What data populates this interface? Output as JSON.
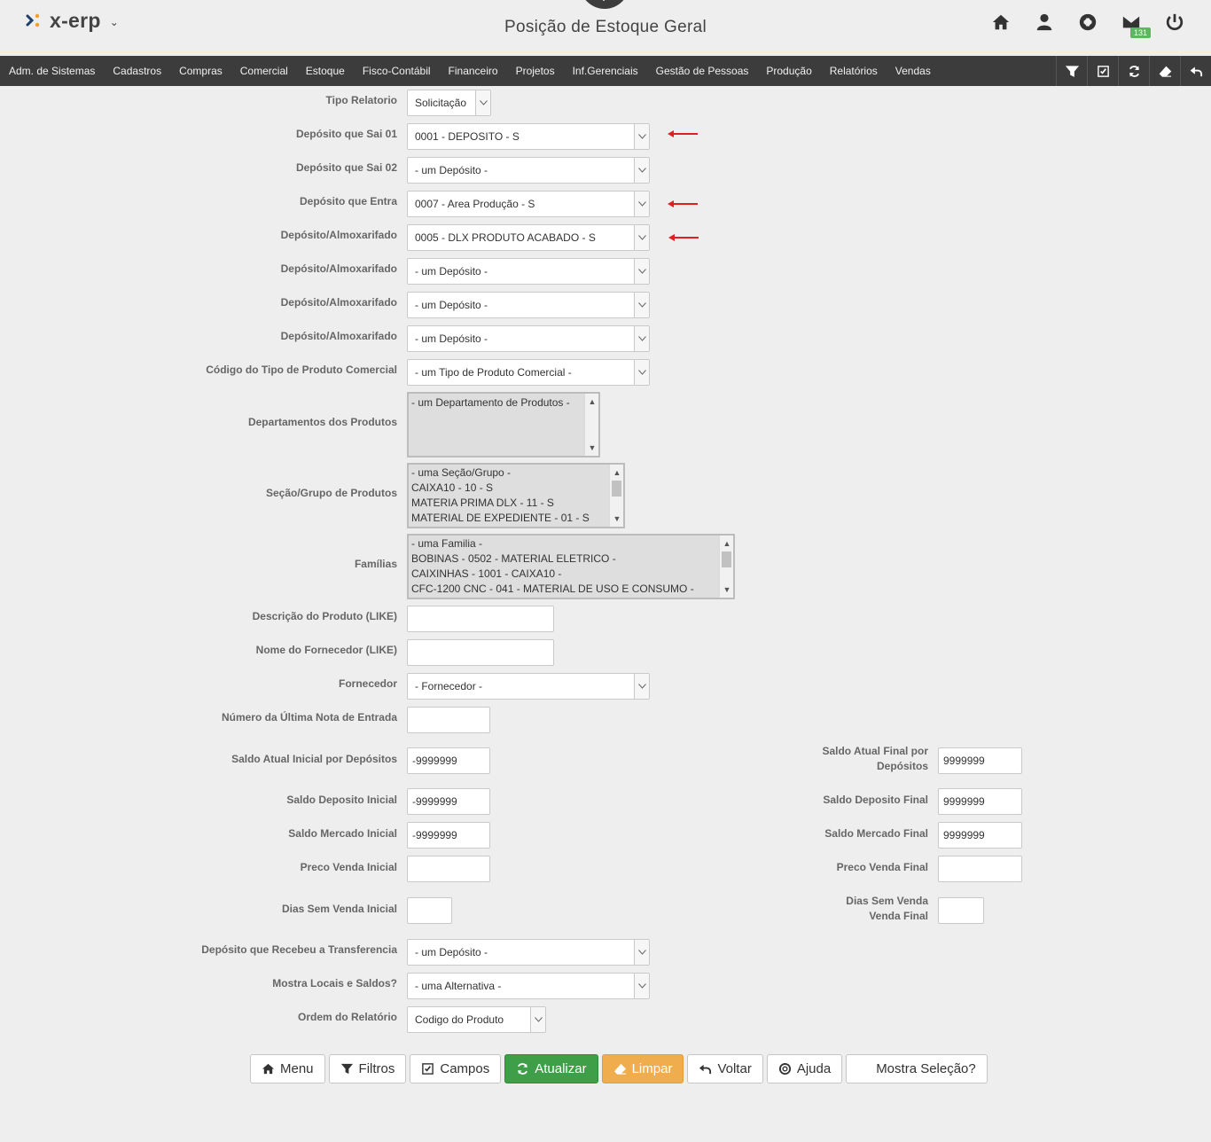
{
  "header": {
    "brand": "x-erp",
    "title": "Posição de Estoque Geral",
    "mail_count": "131",
    "icons": [
      "home-icon",
      "user-icon",
      "lifebuoy-icon",
      "mail-icon",
      "power-icon"
    ]
  },
  "nav": {
    "items": [
      "Adm. de Sistemas",
      "Cadastros",
      "Compras",
      "Comercial",
      "Estoque",
      "Fisco-Contábil",
      "Financeiro",
      "Projetos",
      "Inf.Gerenciais",
      "Gestão de Pessoas",
      "Produção",
      "Relatórios",
      "Vendas"
    ],
    "tools": [
      "filter-icon",
      "checkbox-icon",
      "refresh-icon",
      "eraser-icon",
      "undo-icon"
    ]
  },
  "form": {
    "tipo_relatorio": {
      "label": "Tipo Relatorio",
      "value": "Solicitação"
    },
    "deposito_sai_01": {
      "label": "Depósito que Sai 01",
      "value": "0001 - DEPOSITO - S"
    },
    "deposito_sai_02": {
      "label": "Depósito que Sai 02",
      "value": "- um Depósito -"
    },
    "deposito_entra": {
      "label": "Depósito que Entra",
      "value": "0007 - Area Produção - S"
    },
    "almox_1": {
      "label": "Depósito/Almoxarifado",
      "value": "0005 - DLX PRODUTO ACABADO - S"
    },
    "almox_2": {
      "label": "Depósito/Almoxarifado",
      "value": "- um Depósito -"
    },
    "almox_3": {
      "label": "Depósito/Almoxarifado",
      "value": "- um Depósito -"
    },
    "almox_4": {
      "label": "Depósito/Almoxarifado",
      "value": "- um Depósito -"
    },
    "tipo_produto": {
      "label": "Código do Tipo de Produto Comercial",
      "value": "- um Tipo de Produto Comercial -"
    },
    "departamentos": {
      "label": "Departamentos dos Produtos",
      "options": [
        "- um Departamento de Produtos -"
      ]
    },
    "secao": {
      "label": "Seção/Grupo de Produtos",
      "options": [
        "- uma Seção/Grupo -",
        "CAIXA10 - 10 - S",
        "MATERIA PRIMA DLX - 11 - S",
        "MATERIAL DE EXPEDIENTE - 01 - S"
      ]
    },
    "familias": {
      "label": "Famílias",
      "options": [
        "- uma Familia -",
        "BOBINAS - 0502 - MATERIAL ELETRICO -",
        "CAIXINHAS - 1001 - CAIXA10 -",
        "CFC-1200 CNC - 041 - MATERIAL DE USO E CONSUMO -"
      ]
    },
    "descricao_produto": {
      "label": "Descrição do Produto (LIKE)",
      "value": ""
    },
    "nome_fornecedor": {
      "label": "Nome do Fornecedor (LIKE)",
      "value": ""
    },
    "fornecedor": {
      "label": "Fornecedor",
      "value": "- Fornecedor -"
    },
    "ultima_nota": {
      "label": "Número da Última Nota de Entrada",
      "value": ""
    },
    "saldo_atual_inicial": {
      "label": "Saldo Atual Inicial por Depósitos",
      "value": "-9999999"
    },
    "saldo_atual_final": {
      "label": "Saldo Atual Final por Depósitos",
      "value": "9999999"
    },
    "saldo_deposito_inicial": {
      "label": "Saldo Deposito Inicial",
      "value": "-9999999"
    },
    "saldo_deposito_final": {
      "label": "Saldo Deposito Final",
      "value": "9999999"
    },
    "saldo_mercado_inicial": {
      "label": "Saldo Mercado Inicial",
      "value": "-9999999"
    },
    "saldo_mercado_final": {
      "label": "Saldo Mercado Final",
      "value": "9999999"
    },
    "preco_venda_inicial": {
      "label": "Preco Venda Inicial",
      "value": ""
    },
    "preco_venda_final": {
      "label": "Preco Venda Final",
      "value": ""
    },
    "dias_sem_venda_inicial": {
      "label": "Dias Sem Venda Inicial",
      "value": ""
    },
    "dias_sem_venda_final": {
      "label": "Dias Sem Venda Venda Final",
      "value": ""
    },
    "deposito_transferencia": {
      "label": "Depósito que Recebeu a Transferencia",
      "value": "- um Depósito -"
    },
    "mostra_locais": {
      "label": "Mostra Locais e Saldos?",
      "value": "- uma Alternativa -"
    },
    "ordem_relatorio": {
      "label": "Ordem do Relatório",
      "value": "Codigo do Produto"
    }
  },
  "buttons": {
    "menu": "Menu",
    "filtros": "Filtros",
    "campos": "Campos",
    "atualizar": "Atualizar",
    "limpar": "Limpar",
    "voltar": "Voltar",
    "ajuda": "Ajuda",
    "mostra_selecao": "Mostra Seleção?"
  },
  "colors": {
    "nav_bg": "#3c3c3c",
    "primary_green": "#3e9f48",
    "warning_orange": "#f0ad4e",
    "badge_green": "#5cb85c",
    "annotation_red": "#e02020"
  }
}
